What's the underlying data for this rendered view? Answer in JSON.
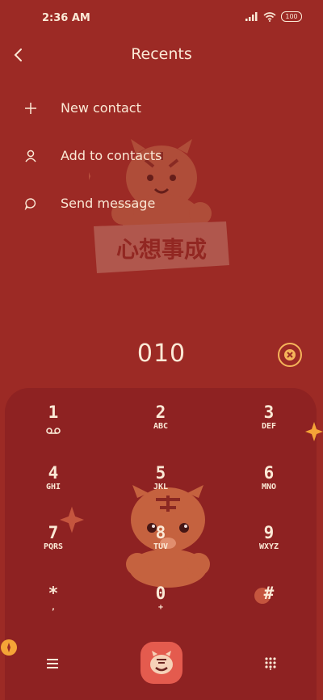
{
  "status": {
    "time": "2:36 AM",
    "battery": "100"
  },
  "header": {
    "title": "Recents"
  },
  "menu": [
    {
      "label": "New contact",
      "icon": "plus-icon"
    },
    {
      "label": "Add to contacts",
      "icon": "person-icon"
    },
    {
      "label": "Send message",
      "icon": "chat-bubble-icon"
    }
  ],
  "decor": {
    "banner_text": "心想事成"
  },
  "dialed_number": "010",
  "keypad": [
    {
      "digit": "1",
      "letters": ""
    },
    {
      "digit": "2",
      "letters": "ABC"
    },
    {
      "digit": "3",
      "letters": "DEF"
    },
    {
      "digit": "4",
      "letters": "GHI"
    },
    {
      "digit": "5",
      "letters": "JKL"
    },
    {
      "digit": "6",
      "letters": "MNO"
    },
    {
      "digit": "7",
      "letters": "PQRS"
    },
    {
      "digit": "8",
      "letters": "TUV"
    },
    {
      "digit": "9",
      "letters": "WXYZ"
    },
    {
      "digit": "*",
      "letters": ","
    },
    {
      "digit": "0",
      "letters": "+"
    },
    {
      "digit": "#",
      "letters": ""
    }
  ],
  "colors": {
    "background": "#9c2a25",
    "pad": "#8e2222",
    "text": "#fbe9d6",
    "accent": "#f5b45a",
    "call": "#e45b4e"
  }
}
